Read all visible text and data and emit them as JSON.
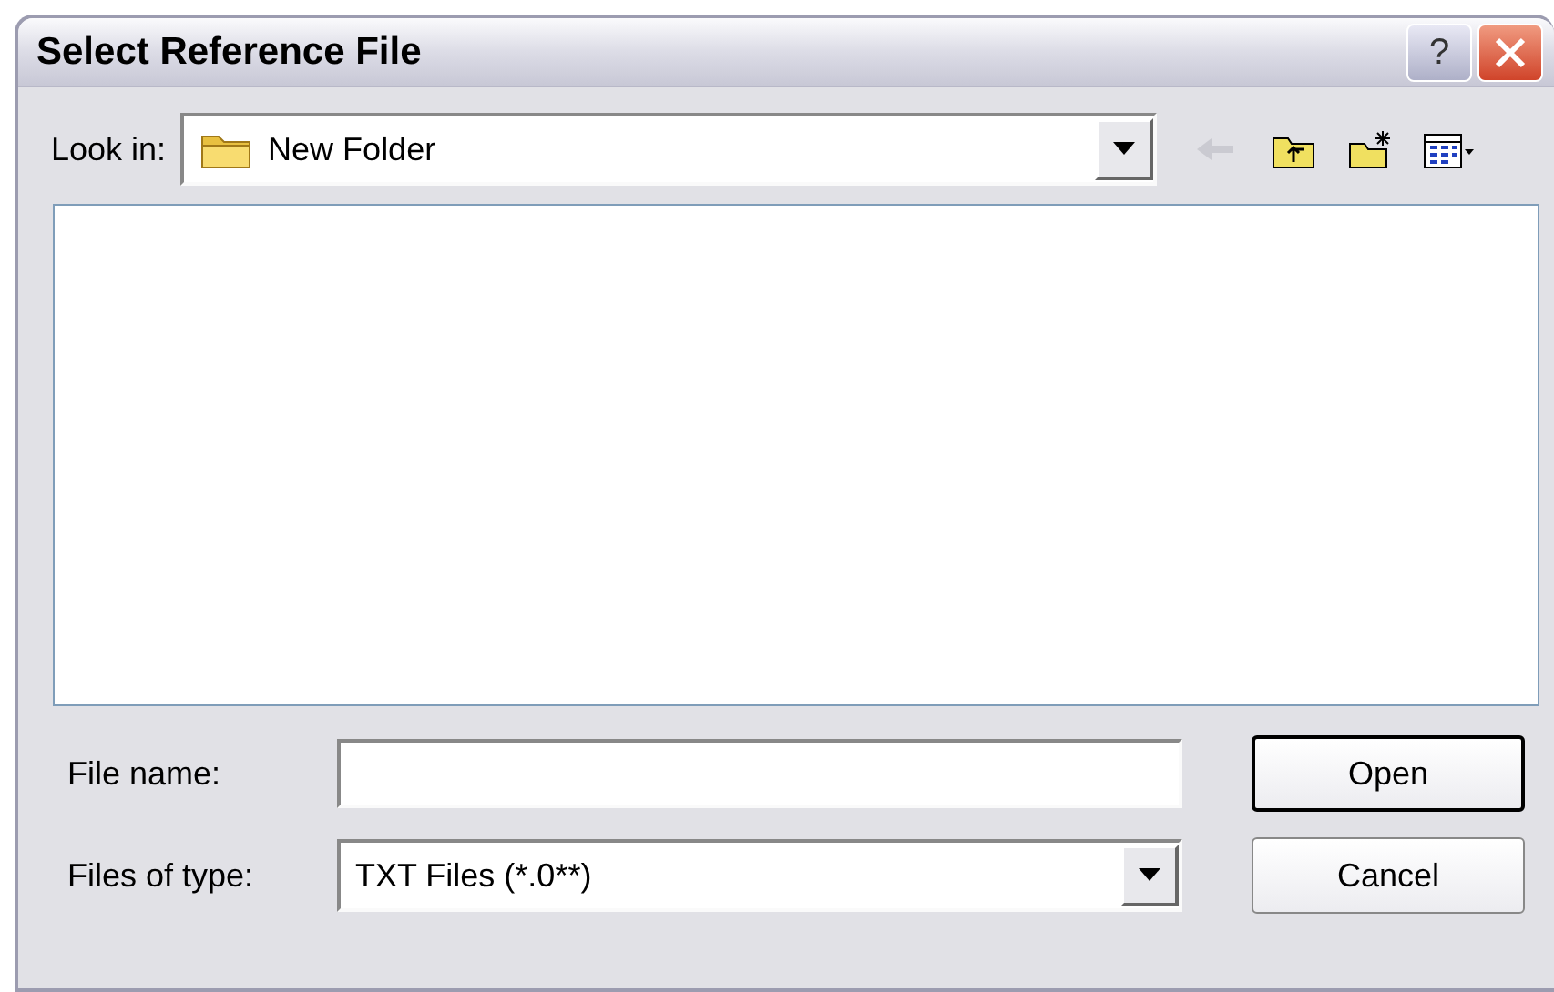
{
  "window": {
    "title": "Select Reference File"
  },
  "title_buttons": [
    {
      "kind": "help",
      "label": "?"
    },
    {
      "kind": "close"
    }
  ],
  "look_in": {
    "label": "Look in:",
    "value": "New Folder"
  },
  "toolbar": [
    {
      "kind": "back",
      "disabled": true
    },
    {
      "kind": "up",
      "disabled": false
    },
    {
      "kind": "new-folder",
      "disabled": false
    },
    {
      "kind": "view",
      "disabled": false
    }
  ],
  "file_name": {
    "label": "File name:"
  },
  "file_type": {
    "label": "Files of type:",
    "value": "TXT Files (*.0**)"
  },
  "buttons": [
    {
      "label": "Open",
      "default": true
    },
    {
      "label": "Cancel",
      "default": false
    }
  ]
}
